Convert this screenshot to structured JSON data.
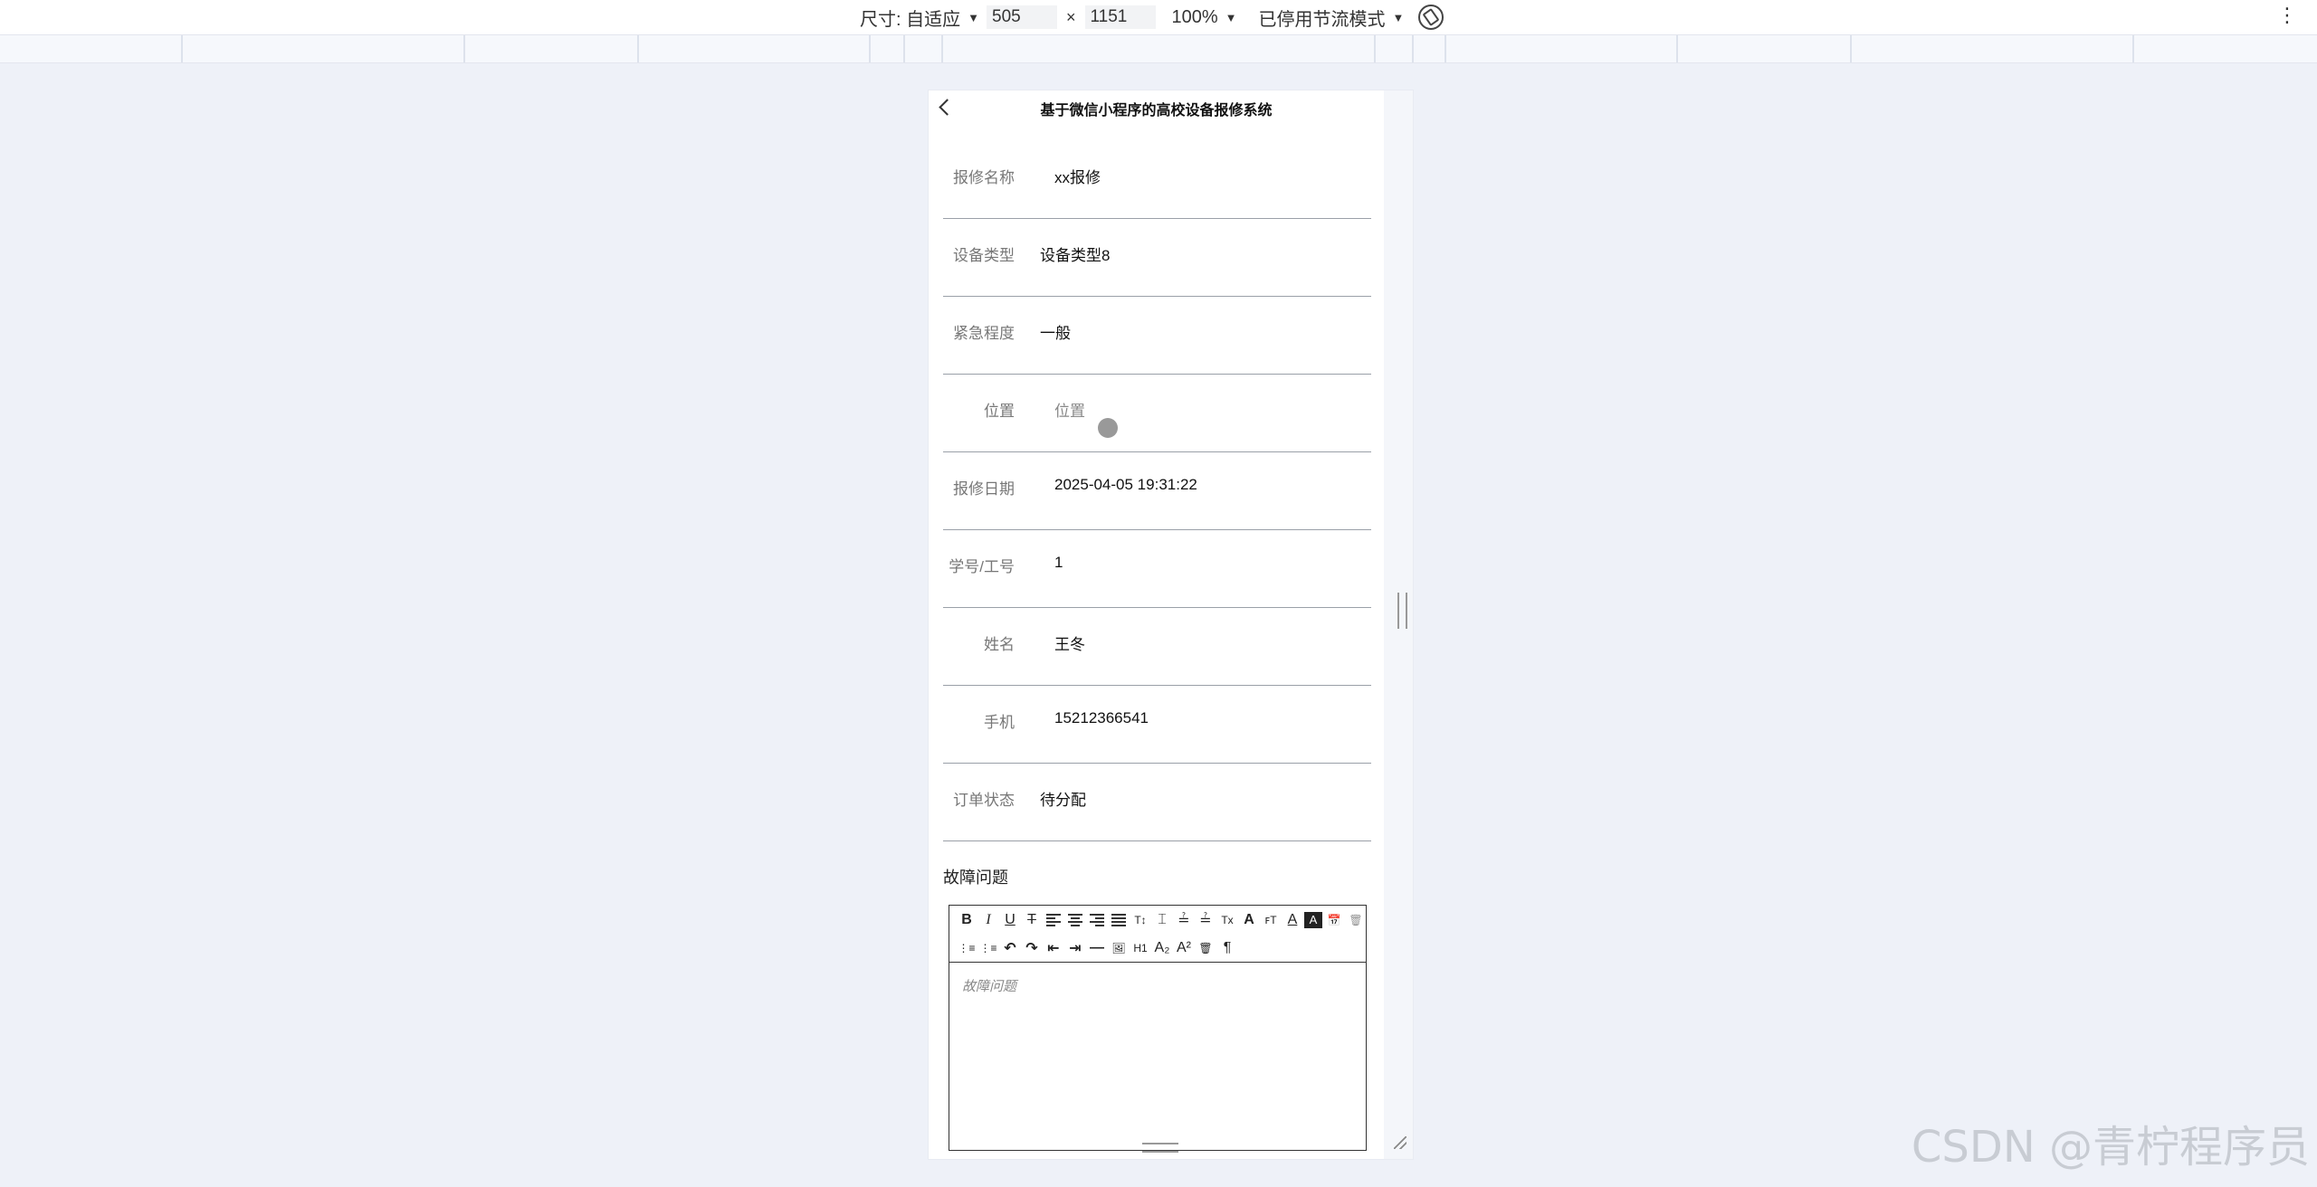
{
  "devtools": {
    "size_label": "尺寸: 自适应",
    "width": "505",
    "times": "×",
    "height": "1151",
    "zoom": "100%",
    "throttle": "已停用节流模式"
  },
  "app": {
    "title": "基于微信小程序的高校设备报修系统"
  },
  "form": {
    "rows": [
      {
        "label": "报修名称",
        "value": "xx报修"
      },
      {
        "label": "设备类型",
        "value": "设备类型8"
      },
      {
        "label": "紧急程度",
        "value": "一般"
      },
      {
        "label": "位置",
        "value": "位置"
      },
      {
        "label": "报修日期",
        "value": "2025-04-05 19:31:22"
      },
      {
        "label": "学号/工号",
        "value": "1"
      },
      {
        "label": "姓名",
        "value": "王冬"
      },
      {
        "label": "手机",
        "value": "15212366541"
      },
      {
        "label": "订单状态",
        "value": "待分配"
      }
    ]
  },
  "editor": {
    "label": "故障问题",
    "placeholder": "故障问题",
    "toolbar_row1": [
      "B",
      "I",
      "U",
      "T",
      "≡",
      "≡",
      "≡",
      "≡",
      "T↕",
      "⌶",
      "≟",
      "≟",
      "Tx",
      "A",
      "ꜰT",
      "A",
      "A",
      "📅",
      "🗑"
    ],
    "toolbar_row2": [
      "⋮≡",
      "⋮≡",
      "↶",
      "↷",
      "⇤",
      "⇥",
      "—",
      "🖼",
      "H1",
      "A₂",
      "A²",
      "🗑",
      "¶"
    ]
  },
  "watermark": "CSDN @青柠程序员"
}
